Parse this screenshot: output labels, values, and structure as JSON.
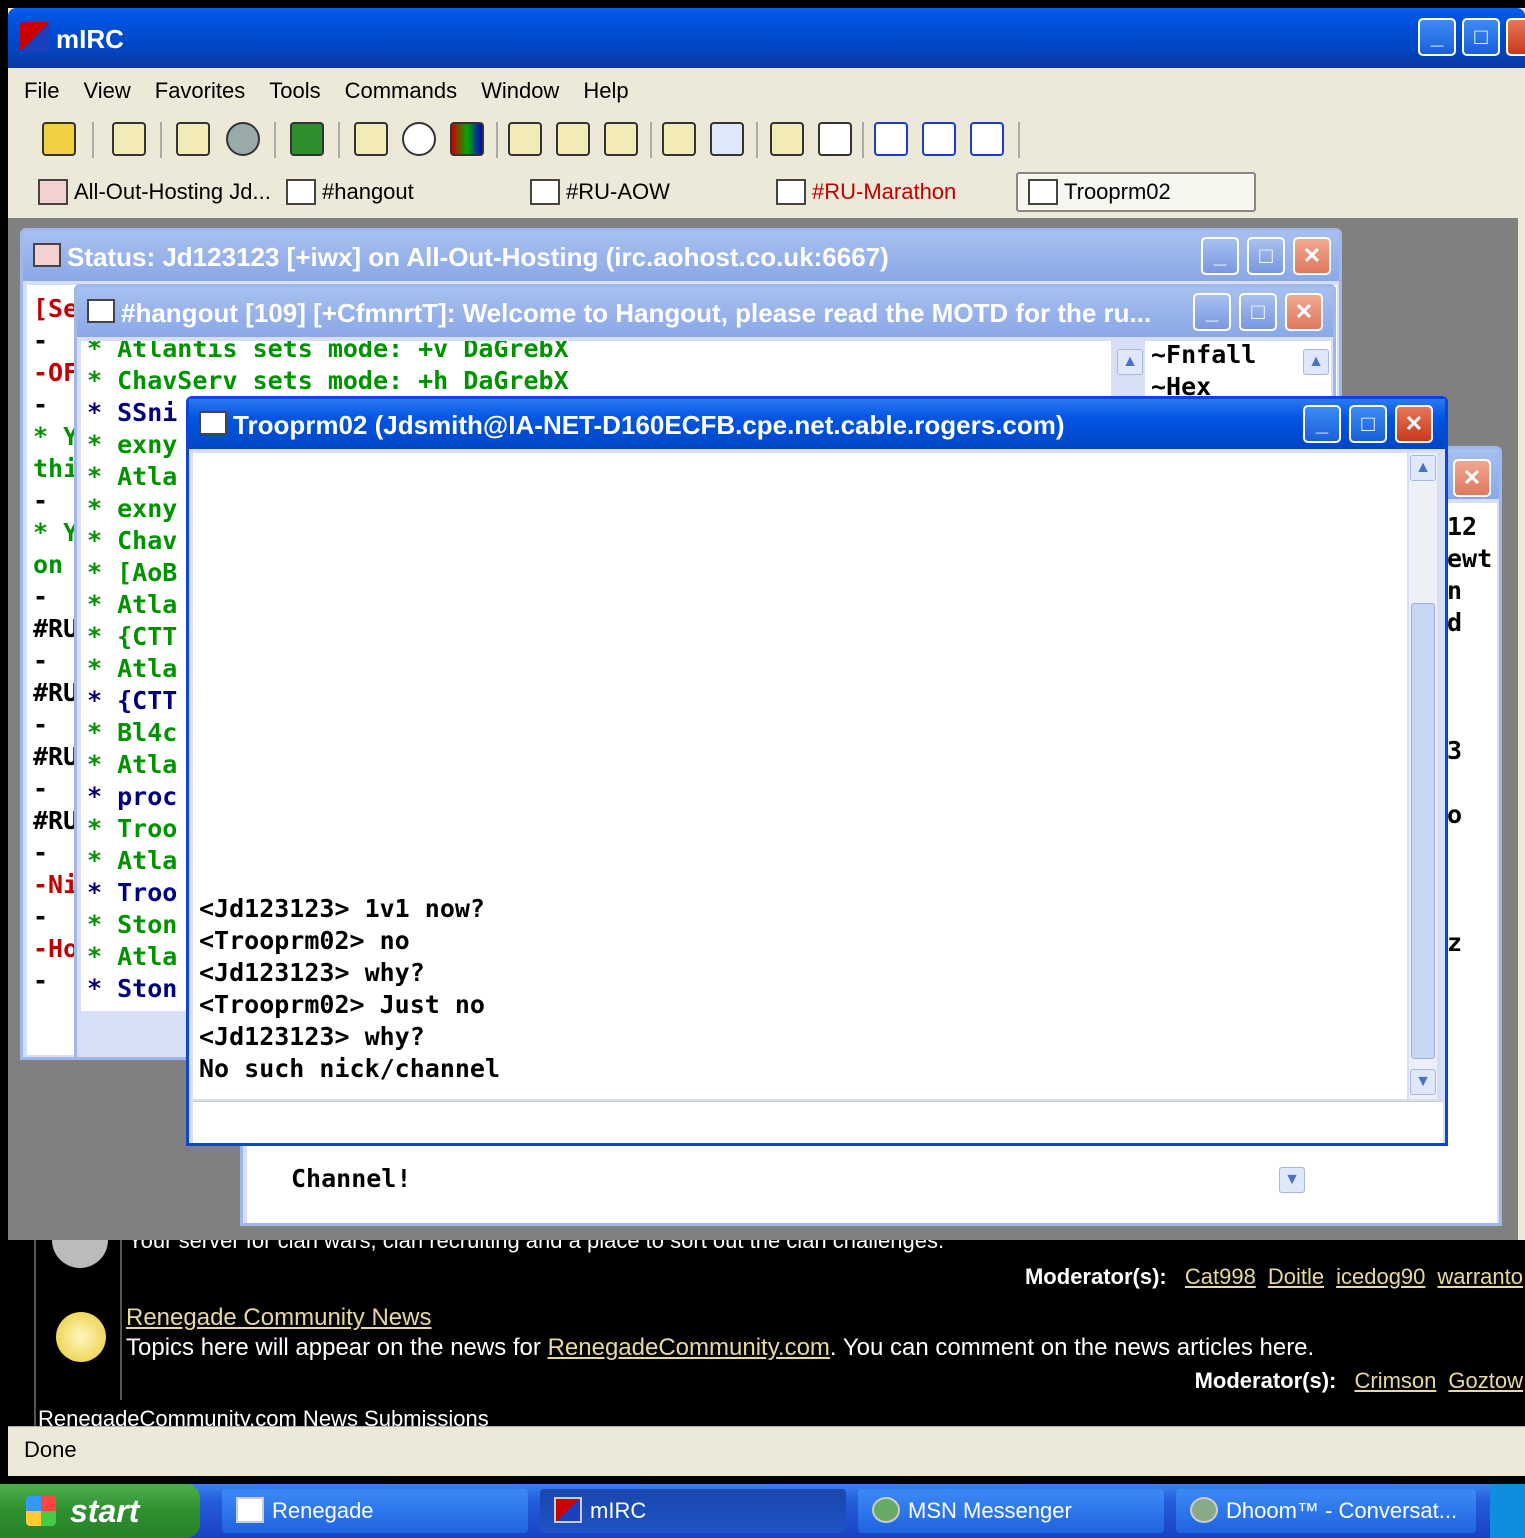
{
  "app": {
    "title": "mIRC",
    "menu": [
      "File",
      "View",
      "Favorites",
      "Tools",
      "Commands",
      "Window",
      "Help"
    ],
    "switchbar": [
      {
        "label": "All-Out-Hosting Jd...",
        "color": "#000000"
      },
      {
        "label": "#hangout",
        "color": "#000000"
      },
      {
        "label": "#RU-AOW",
        "color": "#000000"
      },
      {
        "label": "#RU-Marathon",
        "color": "#c00000"
      },
      {
        "label": "Trooprm02",
        "color": "#000000"
      }
    ]
  },
  "status_window": {
    "title": "Status: Jd123123 [+iwx] on All-Out-Hosting (irc.aohost.co.uk:6667)",
    "lines": [
      "[Se",
      "-",
      "-OF",
      "-",
      "* Y",
      "thi",
      "-",
      "* Y",
      "on",
      "-",
      "#RU",
      "-",
      "#RU",
      "-",
      "#RU",
      "-",
      "#RU",
      "-",
      "-Ni",
      "-",
      "-Ho",
      "-"
    ]
  },
  "hangout_window": {
    "title": "#hangout [109] [+CfmnrtT]: Welcome to Hangout, please read the MOTD for the ru...",
    "lines": [
      {
        "text": "* Atlantis sets mode: +v DaGrebX",
        "c": "green"
      },
      {
        "text": "* ChavServ sets mode: +h DaGrebX",
        "c": "green"
      },
      {
        "text": "* SSni",
        "c": "navy"
      },
      {
        "text": "* exny",
        "c": "green"
      },
      {
        "text": "* Atla",
        "c": "green"
      },
      {
        "text": "* exny",
        "c": "green"
      },
      {
        "text": "* Chav",
        "c": "green"
      },
      {
        "text": "* [AoB",
        "c": "green"
      },
      {
        "text": "* Atla",
        "c": "green"
      },
      {
        "text": "* {CTT",
        "c": "green"
      },
      {
        "text": "* Atla",
        "c": "green"
      },
      {
        "text": "* {CTT",
        "c": "navy"
      },
      {
        "text": "* Bl4c",
        "c": "green"
      },
      {
        "text": "* Atla",
        "c": "green"
      },
      {
        "text": "* proc",
        "c": "navy"
      },
      {
        "text": "* Troo",
        "c": "green"
      },
      {
        "text": "* Atla",
        "c": "green"
      },
      {
        "text": "* Troo",
        "c": "navy"
      },
      {
        "text": "* Ston",
        "c": "green"
      },
      {
        "text": "* Atla",
        "c": "green"
      },
      {
        "text": "* Ston",
        "c": "navy"
      }
    ],
    "nicklist": [
      "~Fnfall",
      "~Hex"
    ]
  },
  "marathon_window": {
    "right_fragments": [
      "12",
      "ewt",
      "n",
      "d",
      "3",
      "o",
      "z"
    ],
    "bottom_text": "Channel!"
  },
  "query_window": {
    "title": "Trooprm02 (Jdsmith@IA-NET-D160ECFB.cpe.net.cable.rogers.com)",
    "lines": [
      "<Jd123123> 1v1 now?",
      "<Trooprm02> no",
      "<Jd123123> why?",
      "<Trooprm02> Just no",
      "<Jd123123> why?",
      "No such nick/channel"
    ],
    "input_value": ""
  },
  "browser": {
    "partial_top": "Your server for clan wars, clan recruiting and a place to sort out the clan challenges.",
    "moderators_label": "Moderator(s):",
    "mods1": [
      "Cat998",
      "Doitle",
      "icedog90",
      "warranto"
    ],
    "forum_title": "Renegade Community News",
    "forum_desc_pre": "Topics here will appear on the news for ",
    "forum_desc_link": "RenegadeCommunity.com",
    "forum_desc_post": ". You can comment on the news articles here.",
    "mods2": [
      "Crimson",
      "Goztow"
    ],
    "partial_bottom": "RenegadeCommunity.com News Submissions",
    "status": "Done"
  },
  "taskbar": {
    "start": "start",
    "tasks": [
      "Renegade",
      "mIRC",
      "MSN Messenger",
      "Dhoom™ - Conversat..."
    ]
  }
}
